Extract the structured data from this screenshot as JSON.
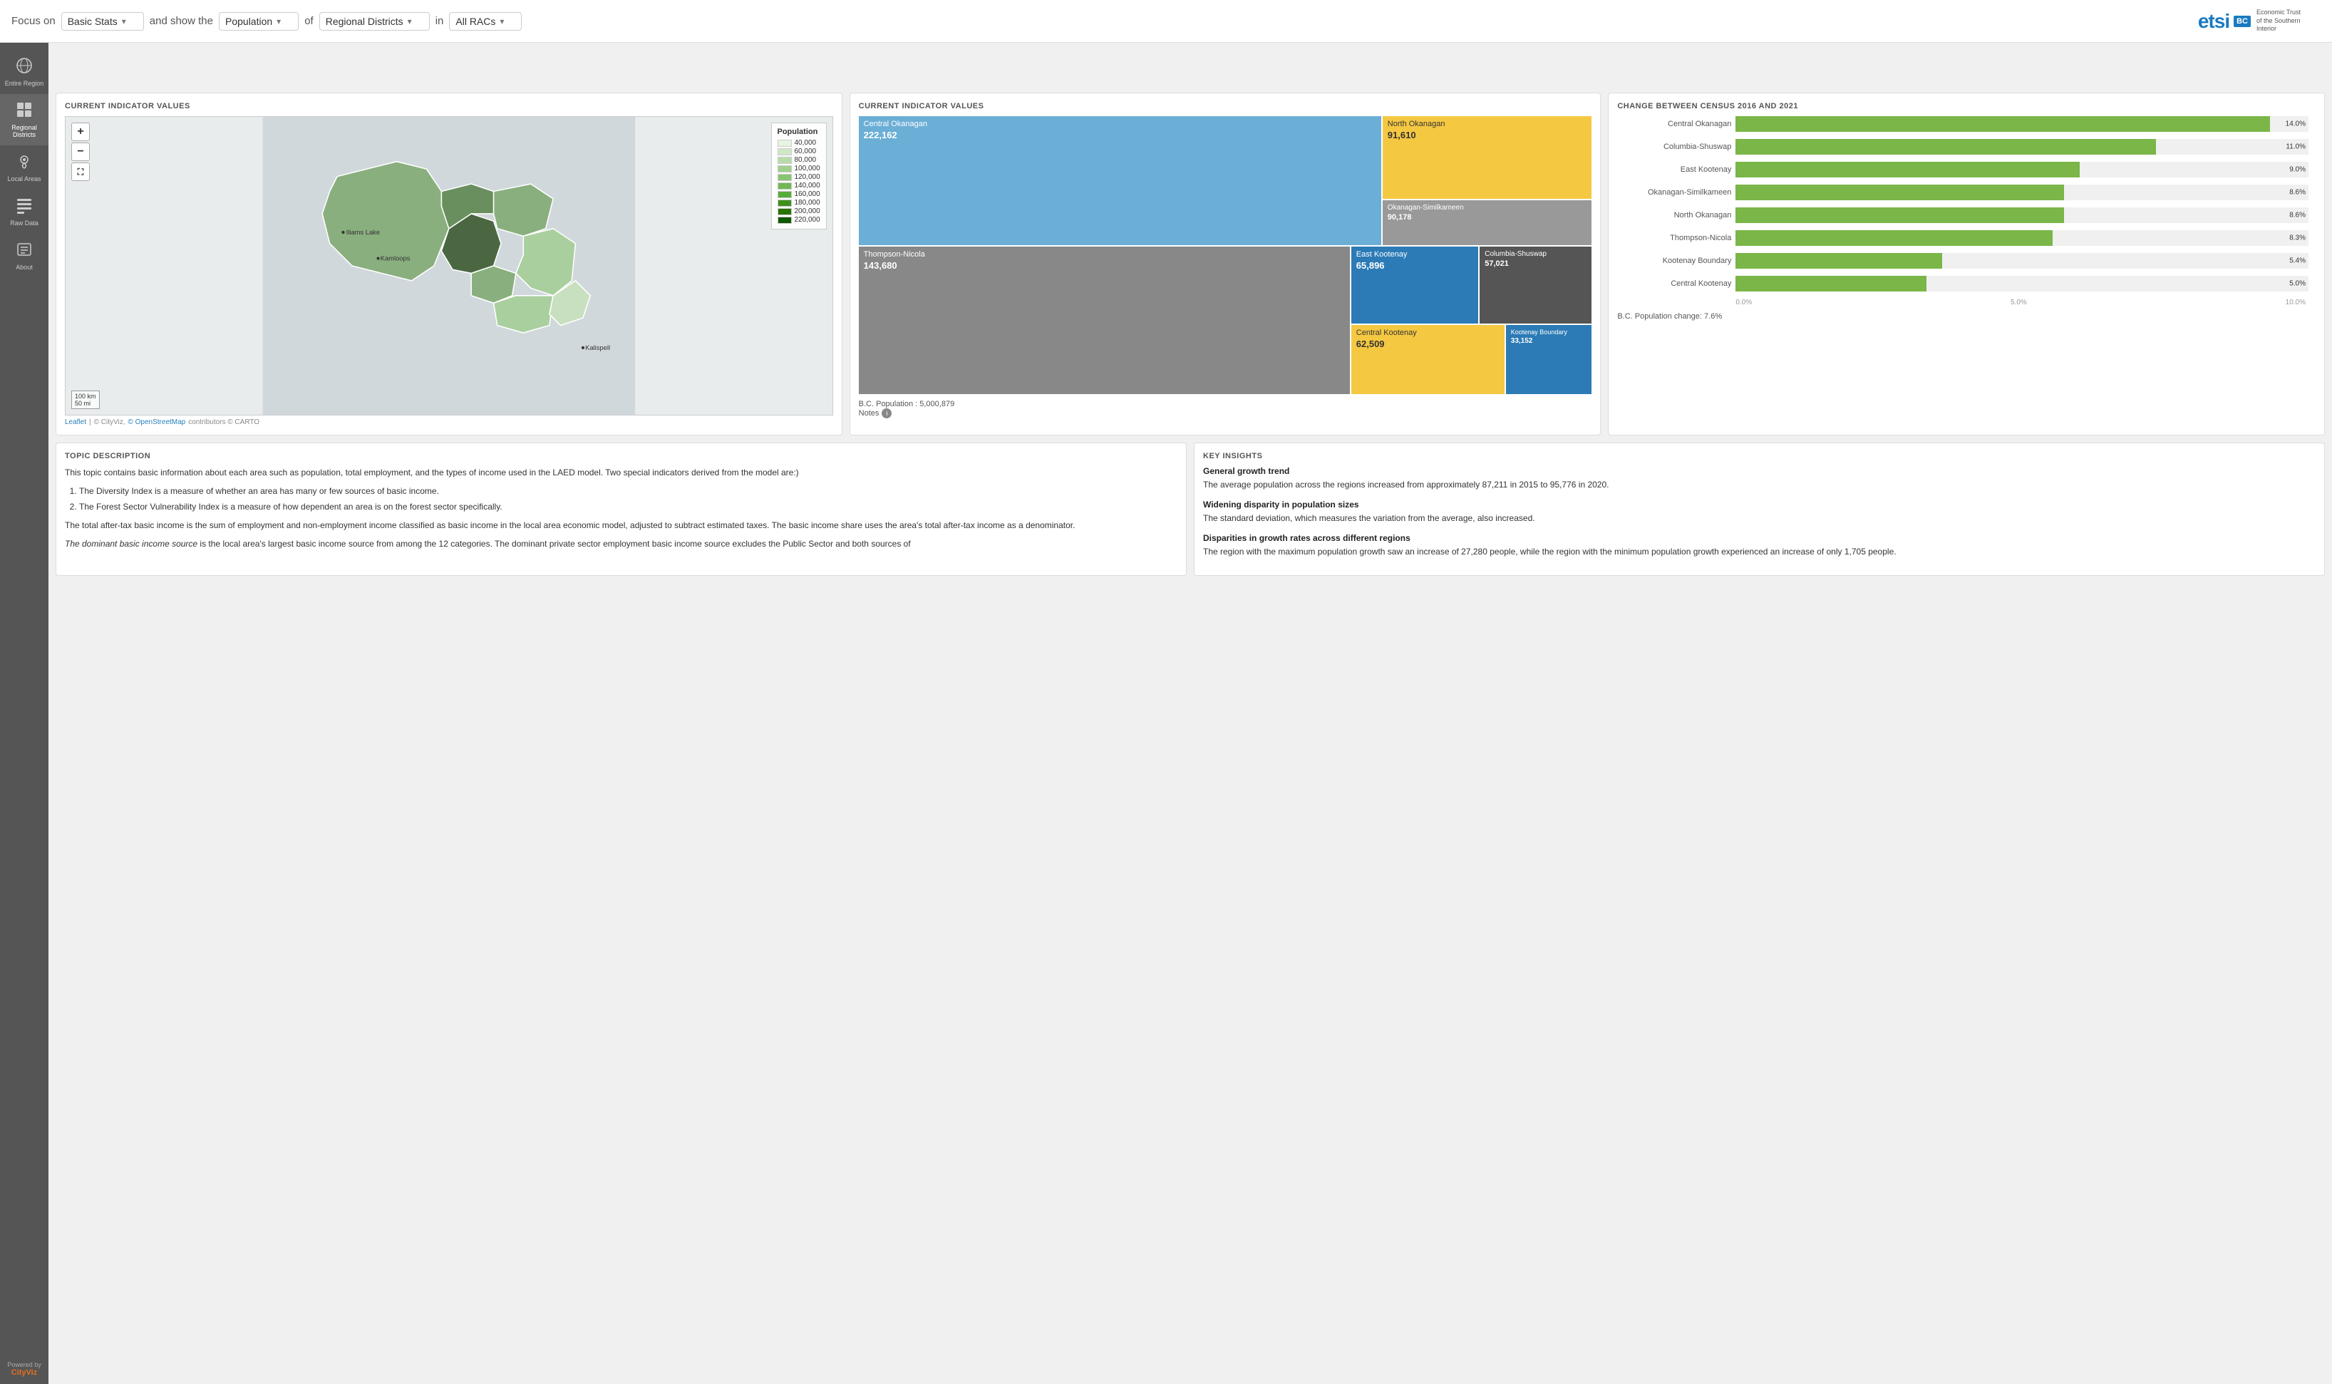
{
  "topbar": {
    "focus_label": "Focus on",
    "basic_stats": "Basic Stats",
    "and_show_label": "and show the",
    "population": "Population",
    "of_label": "of",
    "regional_districts": "Regional Districts",
    "in_label": "in",
    "all_racs": "All RACs"
  },
  "brand": {
    "etsi": "etsi",
    "bc": "BC",
    "tagline": "Economic Trust\nof the Southern Interior"
  },
  "sidebar": {
    "items": [
      {
        "label": "Entire Region",
        "icon": "⊞"
      },
      {
        "label": "Regional Districts",
        "icon": "⊞"
      },
      {
        "label": "Local Areas",
        "icon": "⊞"
      },
      {
        "label": "Raw Data",
        "icon": "⊞"
      },
      {
        "label": "About",
        "icon": "⊞"
      }
    ],
    "powered_by": "Powered by",
    "cityviz": "CityViz"
  },
  "map_card": {
    "title": "CURRENT INDICATOR VALUES",
    "zoom_in": "+",
    "zoom_out": "−",
    "fullscreen": "⛶",
    "legend_title": "Population",
    "legend_items": [
      {
        "value": "40,000",
        "color": "#e8f4e1"
      },
      {
        "value": "60,000",
        "color": "#d0e8c5"
      },
      {
        "value": "80,000",
        "color": "#b8dca9"
      },
      {
        "value": "100,000",
        "color": "#a0d08d"
      },
      {
        "value": "120,000",
        "color": "#88c471"
      },
      {
        "value": "140,000",
        "color": "#70b855"
      },
      {
        "value": "160,000",
        "color": "#58ac39"
      },
      {
        "value": "180,000",
        "color": "#40901d"
      },
      {
        "value": "200,000",
        "color": "#287401"
      },
      {
        "value": "220,000",
        "color": "#105800"
      }
    ],
    "scale_100km": "100 km",
    "scale_50mi": "50 mi",
    "footer_leaflet": "Leaflet",
    "footer_cityviz": "© CityViz",
    "footer_osm": "© OpenStreetMap",
    "footer_carto": "contributors © CARTO",
    "city_kamloops": "Kamloops",
    "city_williams_lake": "Iliams Lake",
    "city_kalispell": "Kalispell"
  },
  "treemap_card": {
    "title": "CURRENT INDICATOR VALUES",
    "tiles": [
      {
        "name": "Central Okanagan",
        "value": "222,162",
        "color": "blue",
        "size": "large"
      },
      {
        "name": "North Okanagan",
        "value": "91,610",
        "color": "yellow",
        "size": "medium"
      },
      {
        "name": "Okanagan-Similkameen",
        "value": "90,178",
        "color": "gray-sm",
        "size": "small"
      },
      {
        "name": "Thompson-Nicola",
        "value": "143,680",
        "color": "dark-gray",
        "size": "medium-large"
      },
      {
        "name": "East Kootenay",
        "value": "65,896",
        "color": "dark-blue",
        "size": "medium"
      },
      {
        "name": "Columbia-Shuswap",
        "value": "57,021",
        "color": "dark-gray2",
        "size": "small-med"
      },
      {
        "name": "Central Kootenay",
        "value": "62,509",
        "color": "yellow2",
        "size": "small-med"
      },
      {
        "name": "Kootenay Boundary",
        "value": "33,152",
        "color": "dark-blue2",
        "size": "small"
      }
    ],
    "bc_population_label": "B.C. Population : 5,000,879",
    "notes_label": "Notes"
  },
  "barchart_card": {
    "title": "CHANGE BETWEEN CENSUS 2016 AND 2021",
    "bars": [
      {
        "label": "Central Okanagan",
        "value": 14.0,
        "display": "14.0%"
      },
      {
        "label": "Columbia-Shuswap",
        "value": 11.0,
        "display": "11.0%"
      },
      {
        "label": "East Kootenay",
        "value": 9.0,
        "display": "9.0%"
      },
      {
        "label": "Okanagan-Similkameen",
        "value": 8.6,
        "display": "8.6%"
      },
      {
        "label": "North Okanagan",
        "value": 8.6,
        "display": "8.6%"
      },
      {
        "label": "Thompson-Nicola",
        "value": 8.3,
        "display": "8.3%"
      },
      {
        "label": "Kootenay Boundary",
        "value": 5.4,
        "display": "5.4%"
      },
      {
        "label": "Central Kootenay",
        "value": 5.0,
        "display": "5.0%"
      }
    ],
    "axis_labels": [
      "0.0%",
      "5.0%",
      "10.0%"
    ],
    "max_value": 15,
    "footer": "B.C. Population change: 7.6%"
  },
  "topic_card": {
    "title": "TOPIC DESCRIPTION",
    "para1": "This topic contains basic information about each area such as population, total employment, and the types of income used in the LAED model. Two special indicators derived from the model are:)",
    "list_items": [
      "The Diversity Index is a measure of whether an area has many or few sources of basic income.",
      "The Forest Sector Vulnerability Index is a measure of how dependent an area is on the forest sector specifically."
    ],
    "para2": "The total after-tax basic income is the sum of employment and non-employment income classified as basic income in the local area economic model, adjusted to subtract estimated taxes. The basic income share uses the area's total after-tax income as a denominator.",
    "para3_italic": "The dominant basic income source",
    "para3_rest": " is the local area's largest basic income source from among the 12 categories. The dominant private sector employment basic income source excludes the Public Sector and both sources of"
  },
  "insights_card": {
    "title": "KEY INSIGHTS",
    "insights": [
      {
        "title": "General growth trend",
        "text": "The average population across the regions increased from approximately 87,211 in 2015 to 95,776 in 2020."
      },
      {
        "title": "Widening disparity in population sizes",
        "text": "The standard deviation, which measures the variation from the average, also increased."
      },
      {
        "title": "Disparities in growth rates across different regions",
        "text": "The region with the maximum population growth saw an increase of 27,280 people, while the region with the minimum population growth experienced an increase of only 1,705 people."
      }
    ]
  }
}
